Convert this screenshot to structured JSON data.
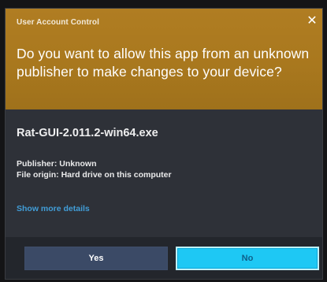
{
  "dialog": {
    "header_title": "User Account Control",
    "close_glyph": "✕",
    "question": "Do you want to allow this app from an unknown publisher to make changes to your device?",
    "app_name": "Rat-GUI-2.011.2-win64.exe",
    "publisher": "Publisher: Unknown",
    "file_origin": "File origin: Hard drive on this computer",
    "show_more_details": "Show more details",
    "buttons": {
      "yes": "Yes",
      "no": "No"
    },
    "colors": {
      "header": "#A9781E",
      "body": "#2E3138",
      "footer": "#23262C",
      "link": "#46B8FF",
      "no_button": "#1EC8F4",
      "yes_button": "#3B4A66"
    },
    "icons": {
      "close": "close-icon"
    }
  }
}
